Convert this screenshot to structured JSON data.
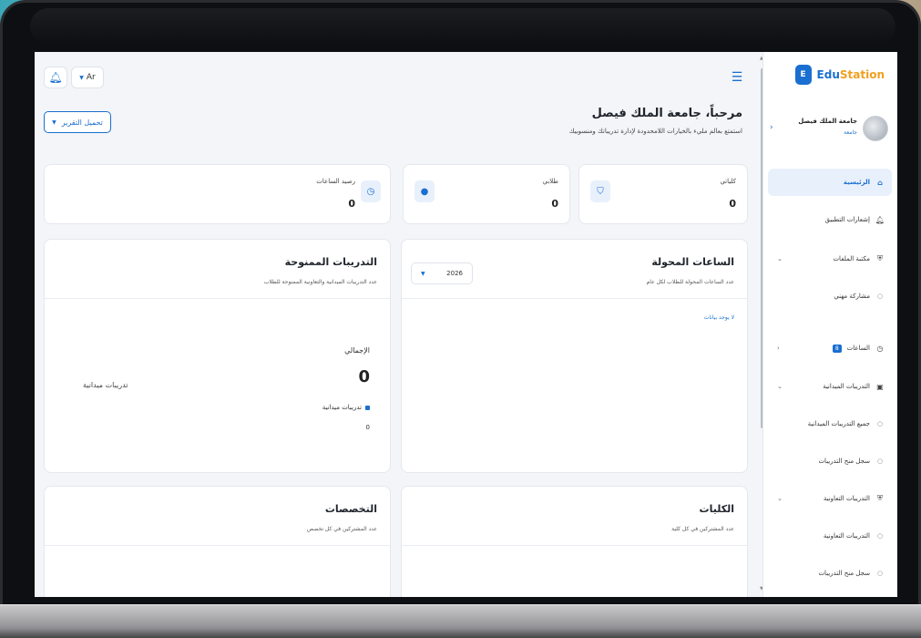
{
  "app": {
    "brand_edu": "Edu",
    "brand_station": "Station",
    "logo_letter": "E"
  },
  "header": {
    "language": "Ar"
  },
  "welcome": {
    "title": "مرحباً، جامعة الملك فيصل",
    "subtitle": "استمتع بعالم مليء بالخيارات اللامحدودة لإدارة تدريباتك ومنسوبيك",
    "download_label": "تحميل التقرير"
  },
  "stats": [
    {
      "label": "كلياتي",
      "value": "0",
      "icon": "graduation-icon"
    },
    {
      "label": "طلابي",
      "value": "0",
      "icon": "user-icon"
    },
    {
      "label": "رصيد الساعات",
      "value": "0",
      "icon": "clock-icon"
    }
  ],
  "panels": {
    "hours": {
      "title": "الساعات المحولة",
      "subtitle": "عدد الساعات المحولة للطلاب لكل عام",
      "year": "2026",
      "no_data": "لا يوجد بيانات"
    },
    "trainings": {
      "title": "التدريبات الممنوحة",
      "subtitle": "عدد التدريبات الميدانية والتعاونية الممنوحة للطلاب",
      "total_label": "الإجمالي",
      "total_value": "0",
      "legend_label": "تدريبات ميدانية",
      "legend_value": "0",
      "pie_label": "تدريبات ميدانية"
    },
    "colleges": {
      "title": "الكليات",
      "subtitle": "عدد المشتركين في كل كلية"
    },
    "majors": {
      "title": "التخصصات",
      "subtitle": "عدد المشتركين في كل تخصص"
    }
  },
  "profile": {
    "name": "جامعة الملك فيصل",
    "role": "جامعة"
  },
  "sidebar": {
    "items": [
      {
        "label": "الرئيسية",
        "icon": "home-icon"
      },
      {
        "label": "إشعارات التطبيق",
        "icon": "bell-icon"
      },
      {
        "label": "مكتبة الملفات",
        "icon": "shield-icon"
      },
      {
        "label": "مشاركة مهني",
        "icon": "circle-icon"
      },
      {
        "label": "الساعات",
        "icon": "clock-icon",
        "badge": "8"
      },
      {
        "label": "التدريبات الميدانية",
        "icon": "book-icon"
      },
      {
        "label": "جميع التدريبات الميدانية",
        "icon": "circle-icon"
      },
      {
        "label": "سجل منح التدريبات",
        "icon": "circle-icon"
      },
      {
        "label": "التدريبات التعاونية",
        "icon": "shield-icon"
      },
      {
        "label": "التدريبات التعاونية",
        "icon": "circle-icon"
      },
      {
        "label": "سجل منح التدريبات",
        "icon": "circle-icon"
      }
    ]
  }
}
